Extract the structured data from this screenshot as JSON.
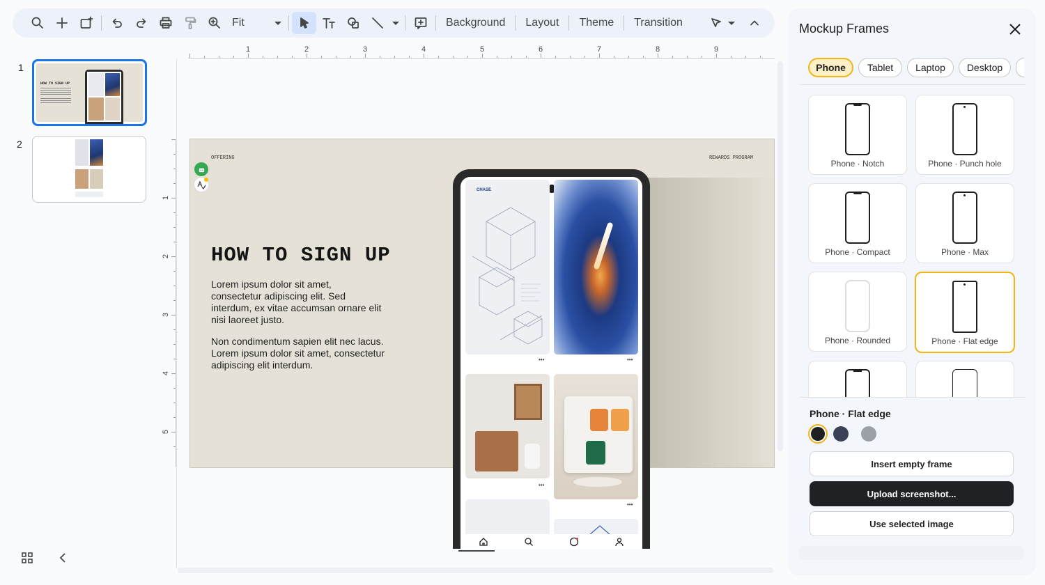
{
  "toolbar": {
    "zoom_label": "Fit",
    "menus": [
      "Background",
      "Layout",
      "Theme",
      "Transition"
    ]
  },
  "ruler": {
    "h_ticks": [
      "1",
      "2",
      "3",
      "4",
      "5",
      "6",
      "7",
      "8",
      "9"
    ],
    "v_ticks": [
      "1",
      "2",
      "3",
      "4",
      "5"
    ]
  },
  "filmstrip": {
    "slide_numbers": [
      "1",
      "2"
    ],
    "thumb_title": "HOW TO SIGN UP"
  },
  "slide": {
    "tag_left": "OFFERING",
    "tag_right": "REWARDS PROGRAM",
    "title": "HOW TO SIGN UP",
    "para1": "Lorem ipsum dolor sit amet, consectetur adipiscing elit. Sed interdum, ex vitae accumsan ornare elit nisi laoreet justo.",
    "para2": "Non condimentum sapien elit nec lacus. Lorem ipsum dolor sit amet, consectetur adipiscing elit interdum.",
    "phone_brand": "CHASE",
    "more_glyph": "•••"
  },
  "panel": {
    "title": "Mockup Frames",
    "tabs": [
      "Phone",
      "Tablet",
      "Laptop",
      "Desktop"
    ],
    "selected_tab": "Phone",
    "frames": [
      "Phone · Notch",
      "Phone · Punch hole",
      "Phone · Compact",
      "Phone · Max",
      "Phone · Rounded",
      "Phone · Flat edge"
    ],
    "selected_frame": "Phone · Flat edge",
    "color_options": [
      "#1f1f1f",
      "#3a4257",
      "#9aa0a6"
    ],
    "insert_label": "Insert empty frame",
    "upload_label": "Upload screenshot...",
    "use_label": "Use selected image"
  },
  "colors": {
    "accent": "#f2b418",
    "selection": "#1a73e8",
    "slide_bg": "#e5e1d6"
  }
}
